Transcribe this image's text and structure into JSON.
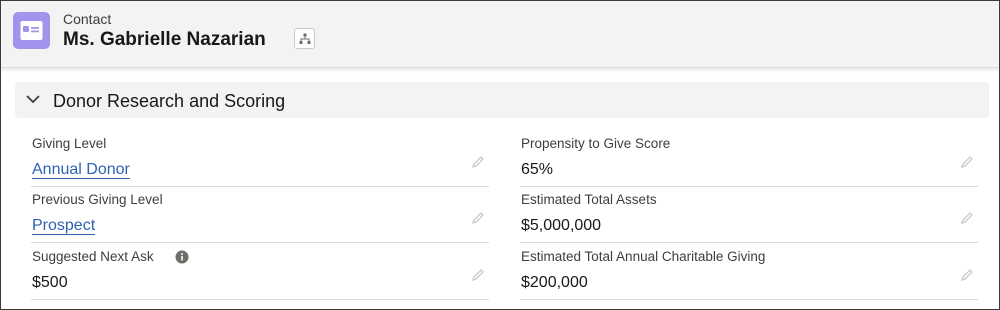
{
  "header": {
    "object_label": "Contact",
    "record_name": "Ms. Gabrielle Nazarian",
    "icon": "contact-card-icon",
    "hierarchy_icon": "hierarchy-icon"
  },
  "section": {
    "title": "Donor Research and Scoring",
    "expanded": true
  },
  "fields": {
    "giving_level": {
      "label": "Giving Level",
      "value": "Annual Donor"
    },
    "previous_giving_level": {
      "label": "Previous Giving Level",
      "value": "Prospect"
    },
    "suggested_next_ask": {
      "label": "Suggested Next Ask",
      "value": "$500"
    },
    "propensity_score": {
      "label": "Propensity to Give Score",
      "value": "65%"
    },
    "estimated_total_assets": {
      "label": "Estimated Total Assets",
      "value": "$5,000,000"
    },
    "estimated_annual_giving": {
      "label": "Estimated Total Annual Charitable Giving",
      "value": "$200,000"
    }
  },
  "colors": {
    "icon_background": "#a094ed",
    "link": "#2e62b3",
    "header_background": "#f3f3f3"
  }
}
